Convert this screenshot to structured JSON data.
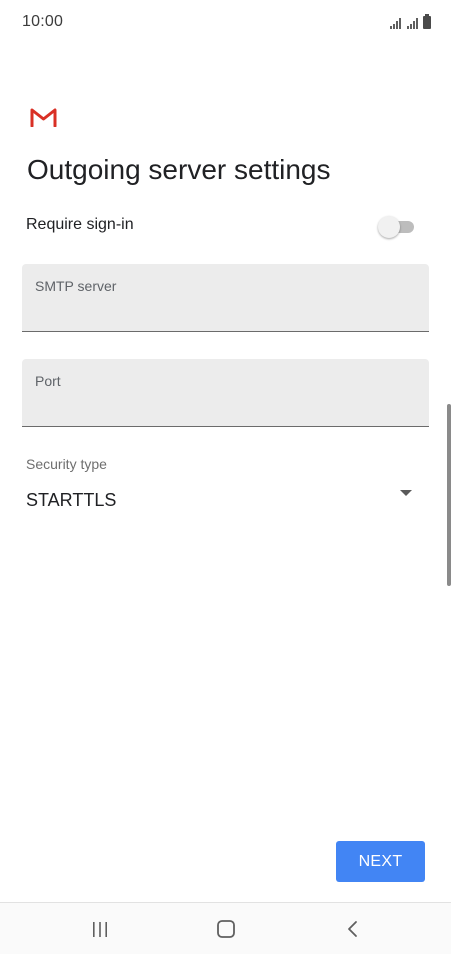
{
  "status_bar": {
    "time": "10:00",
    "icons": [
      "signal-icon",
      "signal-icon",
      "battery-icon"
    ]
  },
  "app": {
    "logo": "gmail-logo",
    "brand_color": "#d93025"
  },
  "page": {
    "title": "Outgoing server settings"
  },
  "require_signin": {
    "label": "Require sign-in",
    "enabled": false
  },
  "fields": {
    "smtp_server": {
      "label": "SMTP server",
      "value": ""
    },
    "port": {
      "label": "Port",
      "value": ""
    }
  },
  "security": {
    "label": "Security type",
    "selected": "STARTTLS"
  },
  "actions": {
    "next_label": "NEXT",
    "accent_color": "#4285f4"
  },
  "nav_bar": {
    "icons": [
      "recents-icon",
      "home-icon",
      "back-icon"
    ]
  }
}
